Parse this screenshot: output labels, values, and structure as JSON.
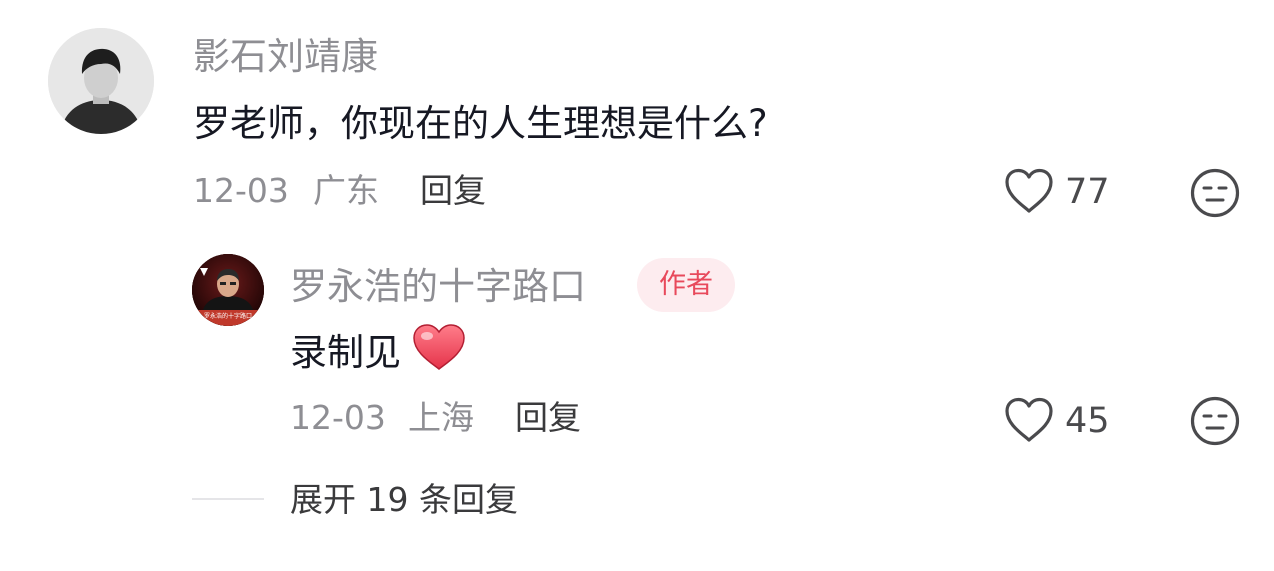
{
  "comment": {
    "author": "影石刘靖康",
    "text": "罗老师，你现在的人生理想是什么?",
    "date": "12-03",
    "location": "广东",
    "reply_label": "回复",
    "likes": "77",
    "like_icon": "heart-outline-icon",
    "dislike_icon": "neutral-face-icon"
  },
  "reply": {
    "author": "罗永浩的十字路口",
    "badge": "作者",
    "text": "录制见",
    "emoji": "heart-emoji",
    "avatar_caption": "罗永浩的十字路口",
    "date": "12-03",
    "location": "上海",
    "reply_label": "回复",
    "likes": "45",
    "like_icon": "heart-outline-icon",
    "dislike_icon": "neutral-face-icon"
  },
  "expand_label": "展开 19 条回复",
  "colors": {
    "badge_bg": "#fdecef",
    "badge_text": "#e8495b",
    "heart_emoji": "#ef4f5e"
  }
}
